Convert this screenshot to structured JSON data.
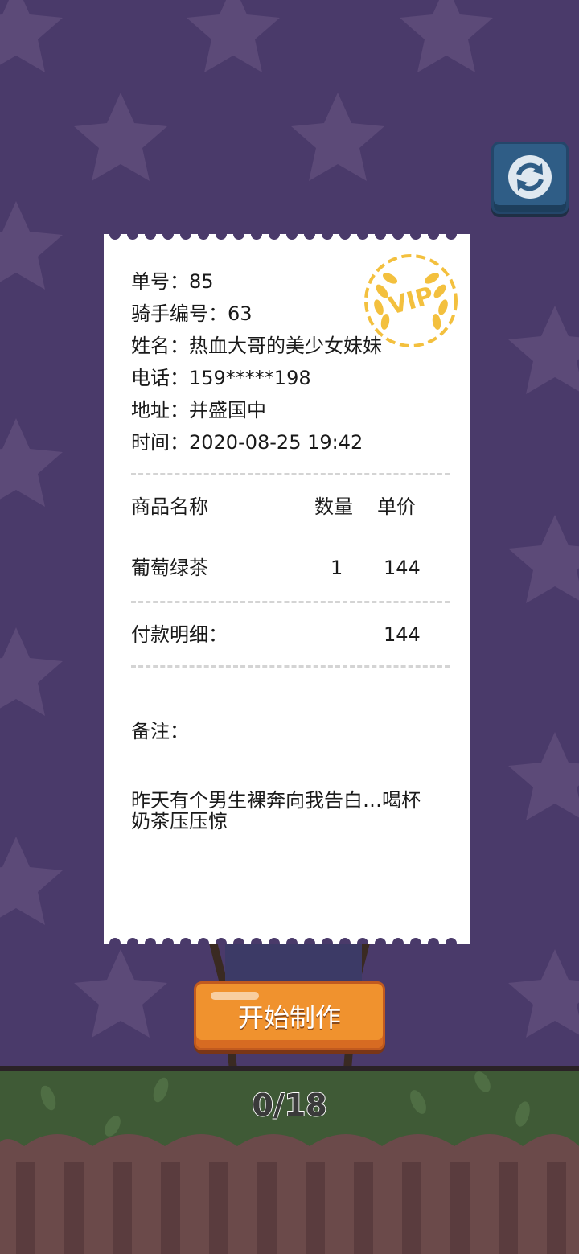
{
  "receipt": {
    "order_no": "单号：85",
    "rider_no": "骑手编号：63",
    "name": "姓名：热血大哥的美少女妹妹",
    "phone": "电话：159*****198",
    "address": "地址：并盛国中",
    "time": "时间：2020-08-25 19:42",
    "header": {
      "item": "商品名称",
      "qty": "数量",
      "price": "单价"
    },
    "items": [
      {
        "name": "葡萄绿茶",
        "qty": "1",
        "price": "144"
      }
    ],
    "payment_label": "付款明细：",
    "payment_total": "144",
    "remark_label": "备注：",
    "remark_text": "昨天有个男生裸奔向我告白…喝杯奶茶压压惊",
    "badge": "VIP"
  },
  "start_button": {
    "label": "开始制作"
  },
  "progress_text": "0/18",
  "icons": {
    "refresh": "refresh-icon",
    "vip": "vip-badge-icon"
  },
  "colors": {
    "background": "#4a3a6a",
    "button_orange": "#f0922e",
    "refresh_blue": "#2f5d86",
    "grass": "#3f5a36"
  }
}
